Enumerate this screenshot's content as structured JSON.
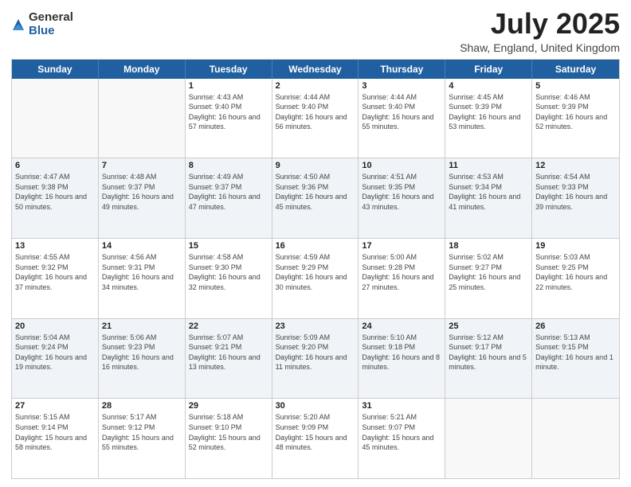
{
  "header": {
    "logo_general": "General",
    "logo_blue": "Blue",
    "month_title": "July 2025",
    "location": "Shaw, England, United Kingdom"
  },
  "weekdays": [
    "Sunday",
    "Monday",
    "Tuesday",
    "Wednesday",
    "Thursday",
    "Friday",
    "Saturday"
  ],
  "rows": [
    [
      {
        "day": "",
        "info": ""
      },
      {
        "day": "",
        "info": ""
      },
      {
        "day": "1",
        "info": "Sunrise: 4:43 AM\nSunset: 9:40 PM\nDaylight: 16 hours and 57 minutes."
      },
      {
        "day": "2",
        "info": "Sunrise: 4:44 AM\nSunset: 9:40 PM\nDaylight: 16 hours and 56 minutes."
      },
      {
        "day": "3",
        "info": "Sunrise: 4:44 AM\nSunset: 9:40 PM\nDaylight: 16 hours and 55 minutes."
      },
      {
        "day": "4",
        "info": "Sunrise: 4:45 AM\nSunset: 9:39 PM\nDaylight: 16 hours and 53 minutes."
      },
      {
        "day": "5",
        "info": "Sunrise: 4:46 AM\nSunset: 9:39 PM\nDaylight: 16 hours and 52 minutes."
      }
    ],
    [
      {
        "day": "6",
        "info": "Sunrise: 4:47 AM\nSunset: 9:38 PM\nDaylight: 16 hours and 50 minutes."
      },
      {
        "day": "7",
        "info": "Sunrise: 4:48 AM\nSunset: 9:37 PM\nDaylight: 16 hours and 49 minutes."
      },
      {
        "day": "8",
        "info": "Sunrise: 4:49 AM\nSunset: 9:37 PM\nDaylight: 16 hours and 47 minutes."
      },
      {
        "day": "9",
        "info": "Sunrise: 4:50 AM\nSunset: 9:36 PM\nDaylight: 16 hours and 45 minutes."
      },
      {
        "day": "10",
        "info": "Sunrise: 4:51 AM\nSunset: 9:35 PM\nDaylight: 16 hours and 43 minutes."
      },
      {
        "day": "11",
        "info": "Sunrise: 4:53 AM\nSunset: 9:34 PM\nDaylight: 16 hours and 41 minutes."
      },
      {
        "day": "12",
        "info": "Sunrise: 4:54 AM\nSunset: 9:33 PM\nDaylight: 16 hours and 39 minutes."
      }
    ],
    [
      {
        "day": "13",
        "info": "Sunrise: 4:55 AM\nSunset: 9:32 PM\nDaylight: 16 hours and 37 minutes."
      },
      {
        "day": "14",
        "info": "Sunrise: 4:56 AM\nSunset: 9:31 PM\nDaylight: 16 hours and 34 minutes."
      },
      {
        "day": "15",
        "info": "Sunrise: 4:58 AM\nSunset: 9:30 PM\nDaylight: 16 hours and 32 minutes."
      },
      {
        "day": "16",
        "info": "Sunrise: 4:59 AM\nSunset: 9:29 PM\nDaylight: 16 hours and 30 minutes."
      },
      {
        "day": "17",
        "info": "Sunrise: 5:00 AM\nSunset: 9:28 PM\nDaylight: 16 hours and 27 minutes."
      },
      {
        "day": "18",
        "info": "Sunrise: 5:02 AM\nSunset: 9:27 PM\nDaylight: 16 hours and 25 minutes."
      },
      {
        "day": "19",
        "info": "Sunrise: 5:03 AM\nSunset: 9:25 PM\nDaylight: 16 hours and 22 minutes."
      }
    ],
    [
      {
        "day": "20",
        "info": "Sunrise: 5:04 AM\nSunset: 9:24 PM\nDaylight: 16 hours and 19 minutes."
      },
      {
        "day": "21",
        "info": "Sunrise: 5:06 AM\nSunset: 9:23 PM\nDaylight: 16 hours and 16 minutes."
      },
      {
        "day": "22",
        "info": "Sunrise: 5:07 AM\nSunset: 9:21 PM\nDaylight: 16 hours and 13 minutes."
      },
      {
        "day": "23",
        "info": "Sunrise: 5:09 AM\nSunset: 9:20 PM\nDaylight: 16 hours and 11 minutes."
      },
      {
        "day": "24",
        "info": "Sunrise: 5:10 AM\nSunset: 9:18 PM\nDaylight: 16 hours and 8 minutes."
      },
      {
        "day": "25",
        "info": "Sunrise: 5:12 AM\nSunset: 9:17 PM\nDaylight: 16 hours and 5 minutes."
      },
      {
        "day": "26",
        "info": "Sunrise: 5:13 AM\nSunset: 9:15 PM\nDaylight: 16 hours and 1 minute."
      }
    ],
    [
      {
        "day": "27",
        "info": "Sunrise: 5:15 AM\nSunset: 9:14 PM\nDaylight: 15 hours and 58 minutes."
      },
      {
        "day": "28",
        "info": "Sunrise: 5:17 AM\nSunset: 9:12 PM\nDaylight: 15 hours and 55 minutes."
      },
      {
        "day": "29",
        "info": "Sunrise: 5:18 AM\nSunset: 9:10 PM\nDaylight: 15 hours and 52 minutes."
      },
      {
        "day": "30",
        "info": "Sunrise: 5:20 AM\nSunset: 9:09 PM\nDaylight: 15 hours and 48 minutes."
      },
      {
        "day": "31",
        "info": "Sunrise: 5:21 AM\nSunset: 9:07 PM\nDaylight: 15 hours and 45 minutes."
      },
      {
        "day": "",
        "info": ""
      },
      {
        "day": "",
        "info": ""
      }
    ]
  ]
}
